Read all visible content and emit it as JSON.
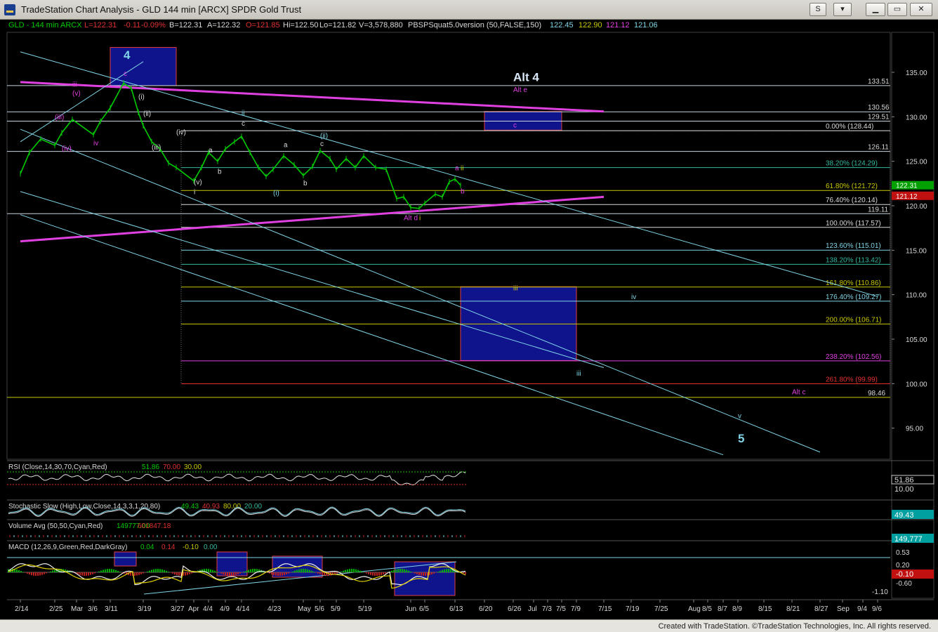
{
  "window": {
    "title": "TradeStation Chart Analysis - GLD 144 min [ARCX] SPDR Gold Trust",
    "btn_s": "S",
    "btn_menu": "▾",
    "btn_min": "▁",
    "btn_max": "▭",
    "btn_close": "✕"
  },
  "header": {
    "symbol": "GLD - 144 min   ARCX",
    "last": "L=122.31",
    "change": "-0.11",
    "change_pct": "-0.09%",
    "bid": "B=122.31",
    "ask": "A=122.32",
    "open": "O=121.85",
    "high": "Hi=122.50",
    "low": "Lo=121.82",
    "volume": "V=3,578,880",
    "study": "PBSPSquat5.0version (50,FALSE,150)",
    "s1": "122.45",
    "s2": "122.90",
    "s3": "121.12",
    "s4": "121.06"
  },
  "colors": {
    "price": "#00cc00",
    "cyan": "#7fd4e6",
    "magenta": "#e040e0",
    "white": "#d8d8d8",
    "yellow": "#c8c800",
    "red": "#e03030",
    "blue_box": "#10148c"
  },
  "chart_data": {
    "type": "line",
    "title": "GLD - 144 min ARCX",
    "ylim": [
      91.5,
      139.5
    ],
    "xlabel": "",
    "ylabel": "",
    "date_ticks": [
      "2/14",
      "2/25",
      "Mar",
      "3/6",
      "3/11",
      "3/19",
      "3/27",
      "Apr",
      "4/4",
      "4/9",
      "4/14",
      "4/23",
      "May",
      "5/6",
      "5/9",
      "5/19",
      "Jun",
      "6/5",
      "6/13",
      "6/20",
      "6/26",
      "Jul",
      "7/3",
      "7/5",
      "7/9",
      "7/15",
      "7/19",
      "7/25",
      "Aug",
      "8/5",
      "8/7",
      "8/9",
      "8/15",
      "8/21",
      "8/27",
      "Sep",
      "9/4",
      "9/6"
    ],
    "y_ticks": [
      135.0,
      130.0,
      125.0,
      120.0,
      115.0,
      110.0,
      105.0,
      100.0,
      95.0
    ],
    "series": [
      {
        "name": "",
        "points": [
          [
            "2/14",
            123.6
          ],
          [
            "2/17",
            126.0
          ],
          [
            "2/20",
            127.5
          ],
          [
            "2/25",
            126.8
          ],
          [
            "2/28",
            128.2
          ],
          [
            "3/4",
            129.7
          ],
          [
            "3/6",
            128.0
          ],
          [
            "3/8",
            129.5
          ],
          [
            "3/11",
            131.0
          ],
          [
            "3/12",
            133.8
          ],
          [
            "3/14",
            133.2
          ],
          [
            "3/16",
            130.5
          ],
          [
            "3/19",
            129.0
          ],
          [
            "3/21",
            127.2
          ],
          [
            "3/23",
            126.4
          ],
          [
            "3/25",
            124.8
          ],
          [
            "3/27",
            124.3
          ],
          [
            "Apr",
            122.8
          ],
          [
            "4/2",
            124.3
          ],
          [
            "4/4",
            126.0
          ],
          [
            "4/7",
            125.0
          ],
          [
            "4/9",
            126.4
          ],
          [
            "4/12",
            127.2
          ],
          [
            "4/14",
            127.8
          ],
          [
            "4/16",
            126.0
          ],
          [
            "4/19",
            124.3
          ],
          [
            "4/21",
            123.3
          ],
          [
            "4/23",
            124.1
          ],
          [
            "4/26",
            125.6
          ],
          [
            "4/29",
            124.6
          ],
          [
            "May",
            123.4
          ],
          [
            "5/3",
            124.4
          ],
          [
            "5/6",
            126.2
          ],
          [
            "5/8",
            125.3
          ],
          [
            "5/9",
            124.1
          ],
          [
            "5/13",
            125.3
          ],
          [
            "5/16",
            124.3
          ],
          [
            "5/19",
            125.6
          ],
          [
            "5/22",
            124.3
          ],
          [
            "5/25",
            124.1
          ],
          [
            "5/28",
            120.8
          ],
          [
            "5/30",
            121.0
          ],
          [
            "Jun",
            119.8
          ],
          [
            "6/3",
            119.7
          ],
          [
            "6/5",
            120.3
          ],
          [
            "6/7",
            121.3
          ],
          [
            "6/9",
            121.0
          ],
          [
            "6/11",
            122.7
          ],
          [
            "6/13",
            123.0
          ],
          [
            "6/14",
            122.3
          ]
        ]
      }
    ],
    "price_markers": [
      {
        "label": "133.51",
        "value": 133.51
      },
      {
        "label": "130.56",
        "value": 130.56
      },
      {
        "label": "129.51",
        "value": 129.51
      },
      {
        "label": "126.11",
        "value": 126.11
      },
      {
        "label": "119.11",
        "value": 119.11
      },
      {
        "label": "98.46",
        "value": 98.46
      },
      {
        "label": "122.31",
        "value": 122.31
      },
      {
        "label": "121.12",
        "value": 121.12
      }
    ],
    "fib_levels": [
      {
        "label": "0.00% (128.44)",
        "value": 128.44,
        "color": "#d8d8d8"
      },
      {
        "label": "38.20% (124.29)",
        "value": 124.29,
        "color": "#33b8a0"
      },
      {
        "label": "61.80% (121.72)",
        "value": 121.72,
        "color": "#c8c800"
      },
      {
        "label": "76.40% (120.14)",
        "value": 120.14,
        "color": "#d8d8d8"
      },
      {
        "label": "100.00% (117.57)",
        "value": 117.57,
        "color": "#d8d8d8"
      },
      {
        "label": "123.60% (115.01)",
        "value": 115.01,
        "color": "#7fd4e6"
      },
      {
        "label": "138.20% (113.42)",
        "value": 113.42,
        "color": "#33b8a0"
      },
      {
        "label": "161.80% (110.86)",
        "value": 110.86,
        "color": "#c8c800"
      },
      {
        "label": "176.40% (109.27)",
        "value": 109.27,
        "color": "#7fd4e6"
      },
      {
        "label": "200.00% (106.71)",
        "value": 106.71,
        "color": "#c8c800"
      },
      {
        "label": "238.20% (102.56)",
        "value": 102.56,
        "color": "#e040e0"
      },
      {
        "label": "261.80% (99.99)",
        "value": 99.99,
        "color": "#e03030"
      }
    ],
    "wave_labels": [
      {
        "text": "4",
        "x": "3/12",
        "y": 136.5,
        "color": "#7fd4e6"
      },
      {
        "text": "c",
        "x": "3/12",
        "y": 134.6,
        "color": "#e040e0"
      },
      {
        "text": "iii",
        "x": "3/4",
        "y": 133.4,
        "color": "#e040e0"
      },
      {
        "text": "(v)",
        "x": "3/4",
        "y": 132.4,
        "color": "#e040e0"
      },
      {
        "text": "(iii)",
        "x": "2/25",
        "y": 129.7,
        "color": "#e040e0"
      },
      {
        "text": "iv",
        "x": "3/6",
        "y": 126.8,
        "color": "#e040e0"
      },
      {
        "text": "(iv)",
        "x": "2/28",
        "y": 126.2,
        "color": "#e040e0"
      },
      {
        "text": "ii",
        "x": "4/14",
        "y": 130.2,
        "color": "#7fd4e6"
      },
      {
        "text": "c",
        "x": "4/14",
        "y": 129.0,
        "color": "#d8d8d8"
      },
      {
        "text": "(ii)",
        "x": "5/6",
        "y": 127.6,
        "color": "#7fd4e6"
      },
      {
        "text": "c",
        "x": "5/6",
        "y": 126.7,
        "color": "#d8d8d8"
      },
      {
        "text": "a",
        "x": "4/4",
        "y": 126.0,
        "color": "#d8d8d8"
      },
      {
        "text": "b",
        "x": "4/7",
        "y": 123.6,
        "color": "#d8d8d8"
      },
      {
        "text": "a",
        "x": "4/26",
        "y": 126.6,
        "color": "#d8d8d8"
      },
      {
        "text": "b",
        "x": "May",
        "y": 122.3,
        "color": "#d8d8d8"
      },
      {
        "text": "(i)",
        "x": "4/23",
        "y": 121.2,
        "color": "#7fd4e6"
      },
      {
        "text": "(v)",
        "x": "Apr",
        "y": 122.4,
        "color": "#d8d8d8"
      },
      {
        "text": "i",
        "x": "Apr",
        "y": 121.3,
        "color": "#d8d8d8"
      },
      {
        "text": "(iv)",
        "x": "3/27",
        "y": 128.0,
        "color": "#d8d8d8"
      },
      {
        "text": "(iii)",
        "x": "3/21",
        "y": 126.3,
        "color": "#d8d8d8"
      },
      {
        "text": "(ii)",
        "x": "3/19",
        "y": 130.1,
        "color": "#d8d8d8"
      },
      {
        "text": "(i)",
        "x": "3/16",
        "y": 132.0,
        "color": "#d8d8d8"
      },
      {
        "text": "a",
        "x": "6/13",
        "y": 124.0,
        "color": "#e040e0"
      },
      {
        "text": "ii",
        "x": "6/14",
        "y": 124.0,
        "color": "#c8c800"
      },
      {
        "text": "b",
        "x": "6/14",
        "y": 121.4,
        "color": "#e040e0"
      },
      {
        "text": "Alt d",
        "x": "5/30",
        "y": 118.4,
        "color": "#e040e0"
      },
      {
        "text": "i",
        "x": "6/3",
        "y": 118.4,
        "color": "#c8c800"
      },
      {
        "text": "Alt 4",
        "x": "6/26",
        "y": 134.0,
        "color": "#d8e8f8"
      },
      {
        "text": "Alt e",
        "x": "6/26",
        "y": 132.8,
        "color": "#e040e0"
      },
      {
        "text": "c",
        "x": "6/26",
        "y": 128.8,
        "color": "#e040e0"
      },
      {
        "text": "iii",
        "x": "6/26",
        "y": 110.5,
        "color": "#c8c800"
      },
      {
        "text": "iv",
        "x": "7/19",
        "y": 109.5,
        "color": "#7fd4e6"
      },
      {
        "text": "iii",
        "x": "7/9",
        "y": 100.9,
        "color": "#7fd4e6"
      },
      {
        "text": "Alt c",
        "x": "8/21",
        "y": 98.8,
        "color": "#e040e0"
      },
      {
        "text": "v",
        "x": "8/9",
        "y": 96.1,
        "color": "#7fd4e6"
      },
      {
        "text": "5",
        "x": "8/9",
        "y": 93.4,
        "color": "#7fd4e6"
      }
    ],
    "boxes": [
      {
        "name": "wave-4-box",
        "x0": "3/11",
        "x1": "3/27",
        "y0": 133.5,
        "y1": 137.8
      },
      {
        "name": "alt-4-c-box",
        "x0": "6/20",
        "x1": "7/5",
        "y0": 128.5,
        "y1": 130.6
      },
      {
        "name": "wave-iii-target-box",
        "x0": "6/14",
        "x1": "7/9",
        "y0": 102.6,
        "y1": 110.9
      }
    ],
    "trendlines": [
      {
        "name": "upper-magenta-line",
        "color": "#e040e0",
        "p": [
          [
            "2/14",
            133.9
          ],
          [
            "7/15",
            130.6
          ]
        ]
      },
      {
        "name": "lower-magenta-line",
        "color": "#e040e0",
        "p": [
          [
            "2/14",
            116.0
          ],
          [
            "7/15",
            121.0
          ]
        ]
      },
      {
        "name": "upper-channel-line",
        "color": "#7fd4e6",
        "p": [
          [
            "2/14",
            137.3
          ],
          [
            "9/6",
            109.8
          ]
        ]
      },
      {
        "name": "middle-channel-line",
        "color": "#7fd4e6",
        "p": [
          [
            "2/14",
            128.6
          ],
          [
            "8/27",
            92.3
          ]
        ]
      },
      {
        "name": "lower-channel-line",
        "color": "#7fd4e6",
        "p": [
          [
            "2/14",
            121.6
          ],
          [
            "7/15",
            101.8
          ]
        ]
      },
      {
        "name": "outer-channel-line",
        "color": "#7fd4e6",
        "p": [
          [
            "2/14",
            119.0
          ],
          [
            "8/7",
            92.0
          ]
        ]
      },
      {
        "name": "upslope-line",
        "color": "#7fd4e6",
        "p": [
          [
            "2/14",
            127.2
          ],
          [
            "3/19",
            136.2
          ]
        ]
      }
    ],
    "indicators": [
      {
        "name": "RSI",
        "label": "RSI (Close,14,30,70,Cyan,Red)",
        "values": [
          "51.86",
          "70.00",
          "30.00"
        ],
        "axis": [
          "51.86",
          "10.00"
        ]
      },
      {
        "name": "Stochastic Slow",
        "label": "Stochastic Slow (High,Low,Close,14,3,3,1,20,80)",
        "values": [
          "49.43",
          "40.93",
          "80.00",
          "20.00"
        ],
        "axis": [
          "49.43"
        ]
      },
      {
        "name": "Volume Avg",
        "label": "Volume Avg (50,50,Cyan,Red)",
        "values": [
          "149777.00",
          "601847.18"
        ],
        "axis": [
          "149,777"
        ]
      },
      {
        "name": "MACD",
        "label": "MACD (12,26,9,Green,Red,DarkGray)",
        "values": [
          "0.04",
          "0.14",
          "-0.10",
          "0.00"
        ],
        "axis": [
          "0.53",
          "0.20",
          "-0.10",
          "-0.60",
          "-1.10"
        ]
      }
    ]
  },
  "footer": {
    "text": "Created with TradeStation. ©TradeStation Technologies, Inc. All rights reserved."
  }
}
